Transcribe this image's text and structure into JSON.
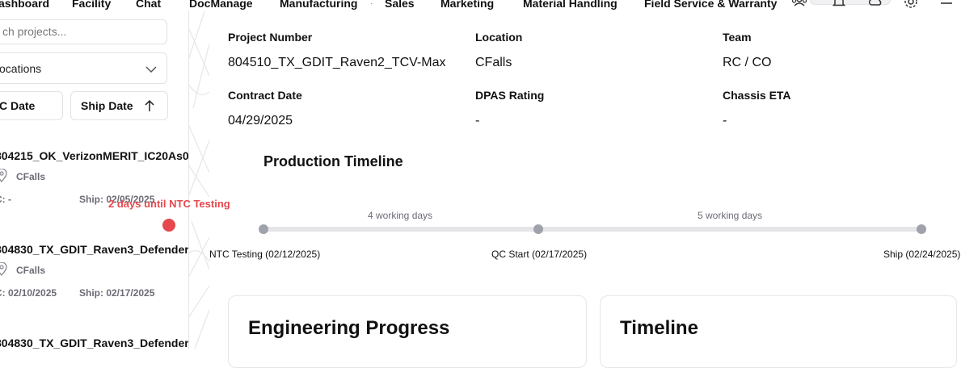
{
  "nav": {
    "items": [
      "ashboard",
      "Facility",
      "Chat",
      "DocManage",
      "Manufacturing",
      "Sales",
      "Marketing",
      "Material Handling",
      "Field Service & Warranty"
    ],
    "icons": [
      "users-icon",
      "bell-icon",
      "cloud-icon",
      "gear-icon",
      "menu-icon"
    ]
  },
  "sidebar": {
    "search_placeholder": "ch projects...",
    "location_filter": "ocations",
    "sort_qc_label": "C Date",
    "sort_ship_label": "Ship Date",
    "projects": [
      {
        "name": "04215_OK_VerizonMERIT_IC20As0",
        "prefix": "8",
        "location": "CFalls",
        "qc": "C: -",
        "ship": "Ship: 02/05/2025"
      },
      {
        "name": "04830_TX_GDIT_Raven3_Defender",
        "prefix": "8",
        "location": "CFalls",
        "qc": "C: 02/10/2025",
        "ship": "Ship: 02/17/2025"
      },
      {
        "name": "04830_TX_GDIT_Raven3_Defender",
        "prefix": "8",
        "location": "",
        "qc": "",
        "ship": ""
      }
    ],
    "alert_text": "2 days until NTC Testing",
    "alert_color": "#e5484d"
  },
  "details": {
    "project_number_label": "Project Number",
    "project_number": "804510_TX_GDIT_Raven2_TCV-Max",
    "location_label": "Location",
    "location": "CFalls",
    "team_label": "Team",
    "team": "RC / CO",
    "contract_date_label": "Contract Date",
    "contract_date": "04/29/2025",
    "dpas_label": "DPAS Rating",
    "dpas": "-",
    "chassis_eta_label": "Chassis ETA",
    "chassis_eta": "-"
  },
  "timeline": {
    "title": "Production Timeline",
    "segments": [
      "4 working days",
      "5 working days"
    ],
    "milestones": [
      "NTC Testing (02/12/2025)",
      "QC Start (02/17/2025)",
      "Ship (02/24/2025)"
    ]
  },
  "cards": {
    "engineering_title": "Engineering Progress",
    "timeline_title": "Timeline"
  }
}
